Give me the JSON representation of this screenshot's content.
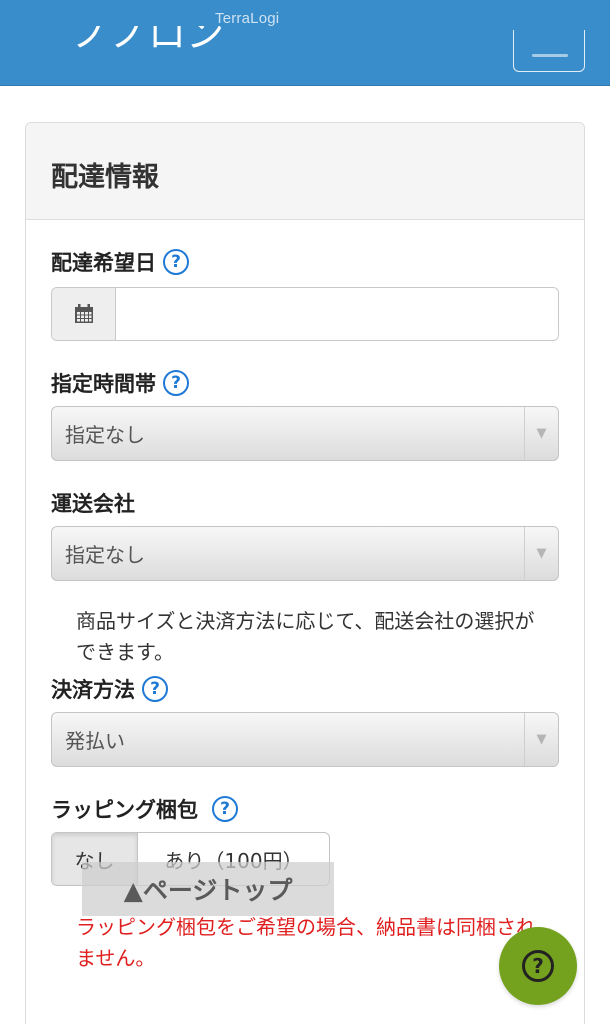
{
  "header": {
    "brand": "TerraLogi",
    "cut_title": "ノノロン",
    "menu_icon": "menu-icon"
  },
  "panel": {
    "title": "配達情報"
  },
  "fields": {
    "delivery_date": {
      "label": "配達希望日",
      "value": "",
      "icon": "calendar-icon",
      "help": "?"
    },
    "time_slot": {
      "label": "指定時間帯",
      "value": "指定なし",
      "help": "?"
    },
    "carrier": {
      "label": "運送会社",
      "value": "指定なし"
    },
    "carrier_note": "商品サイズと決済方法に応じて、配送会社の選択ができます。",
    "payment": {
      "label": "決済方法",
      "value": "発払い",
      "help": "?"
    },
    "wrapping": {
      "label": "ラッピング梱包",
      "help": "?",
      "option_none": "なし",
      "option_yes": "あり（100円）",
      "selected": "なし"
    },
    "wrapping_warning": "ラッピング梱包をご希望の場合、納品書は同梱されません。"
  },
  "overlay": {
    "page_top": "▲ページトップ",
    "help_fab": "?"
  },
  "colors": {
    "header_bg": "#3a8dcb",
    "help_icon": "#1f7ad6",
    "warning_text": "#e02020",
    "fab_bg": "#74a21f"
  }
}
